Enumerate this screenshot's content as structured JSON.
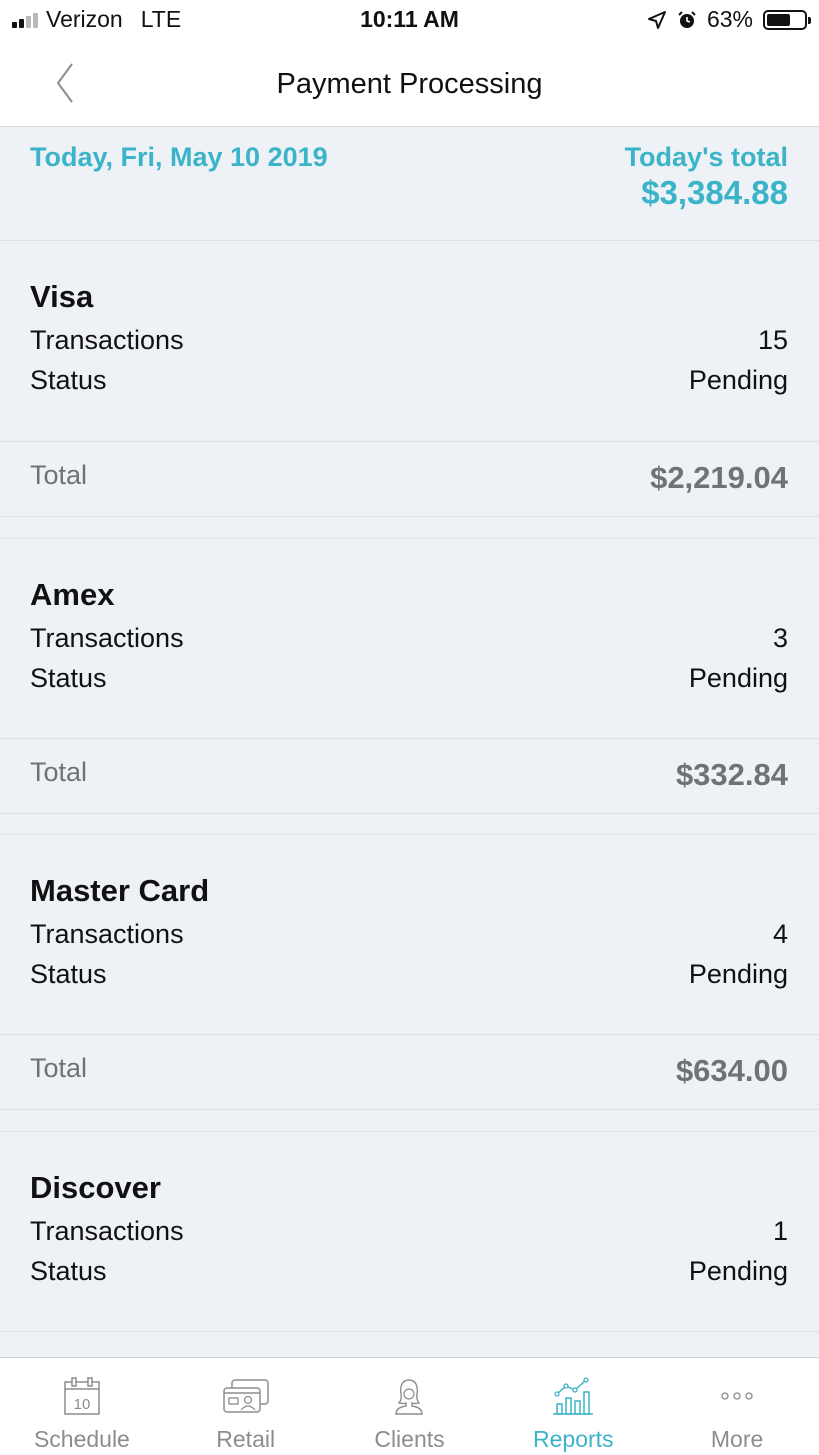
{
  "status_bar": {
    "carrier": "Verizon",
    "network": "LTE",
    "time": "10:11 AM",
    "battery": "63%"
  },
  "nav": {
    "title": "Payment Processing"
  },
  "summary": {
    "date": "Today, Fri, May 10 2019",
    "total_label": "Today's total",
    "total_value": "$3,384.88"
  },
  "cards": [
    {
      "name": "Visa",
      "transactions_label": "Transactions",
      "transactions": "15",
      "status_label": "Status",
      "status": "Pending",
      "total_label": "Total",
      "total": "$2,219.04"
    },
    {
      "name": "Amex",
      "transactions_label": "Transactions",
      "transactions": "3",
      "status_label": "Status",
      "status": "Pending",
      "total_label": "Total",
      "total": "$332.84"
    },
    {
      "name": "Master Card",
      "transactions_label": "Transactions",
      "transactions": "4",
      "status_label": "Status",
      "status": "Pending",
      "total_label": "Total",
      "total": "$634.00"
    },
    {
      "name": "Discover",
      "transactions_label": "Transactions",
      "transactions": "1",
      "status_label": "Status",
      "status": "Pending"
    }
  ],
  "tabs": [
    {
      "label": "Schedule",
      "icon": "calendar-icon",
      "calendar_day": "10"
    },
    {
      "label": "Retail",
      "icon": "retail-icon"
    },
    {
      "label": "Clients",
      "icon": "client-icon"
    },
    {
      "label": "Reports",
      "icon": "reports-icon",
      "active": true
    },
    {
      "label": "More",
      "icon": "more-icon"
    }
  ],
  "colors": {
    "accent": "#3bb4c9",
    "background": "#eef1f5",
    "muted_text": "#6f7378",
    "tab_inactive": "#8a8d91"
  }
}
